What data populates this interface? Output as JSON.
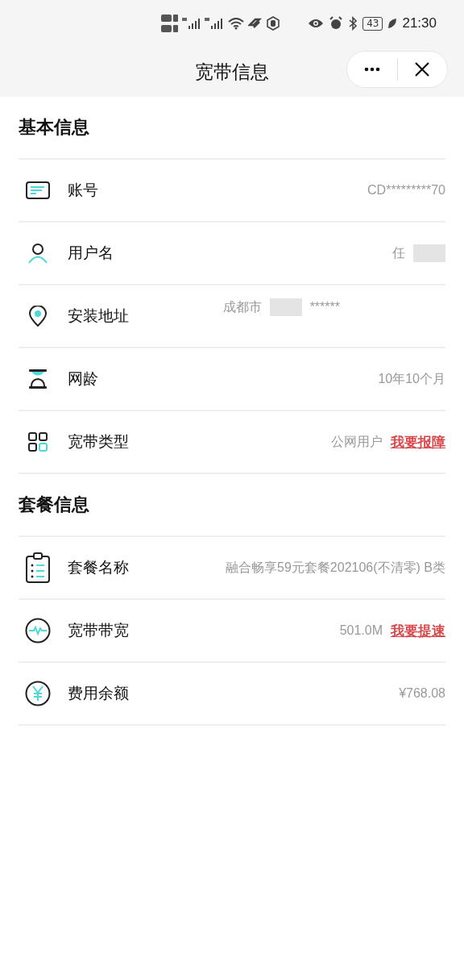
{
  "status_bar": {
    "battery": "43",
    "time": "21:30"
  },
  "nav": {
    "title": "宽带信息"
  },
  "sections": [
    {
      "title": "基本信息",
      "rows": [
        {
          "kind": "card",
          "label": "账号",
          "value": "CD*********70"
        },
        {
          "kind": "person",
          "label": "用户名",
          "value": "任",
          "redacted": true
        },
        {
          "kind": "address",
          "label": "安装地址",
          "value": "成都市",
          "redacted": true,
          "masked": "******"
        },
        {
          "kind": "age",
          "label": "网龄",
          "value": "10年10个月"
        },
        {
          "kind": "type",
          "label": "宽带类型",
          "value": "公网用户",
          "link": "我要报障"
        }
      ]
    },
    {
      "title": "套餐信息",
      "rows": [
        {
          "kind": "plan",
          "label": "套餐名称",
          "value": "融合畅享59元套餐202106(不清零) B类"
        },
        {
          "kind": "speed",
          "label": "宽带带宽",
          "value": "501.0M",
          "link": "我要提速"
        },
        {
          "kind": "balance",
          "label": "费用余额",
          "value": "¥768.08"
        }
      ]
    }
  ]
}
